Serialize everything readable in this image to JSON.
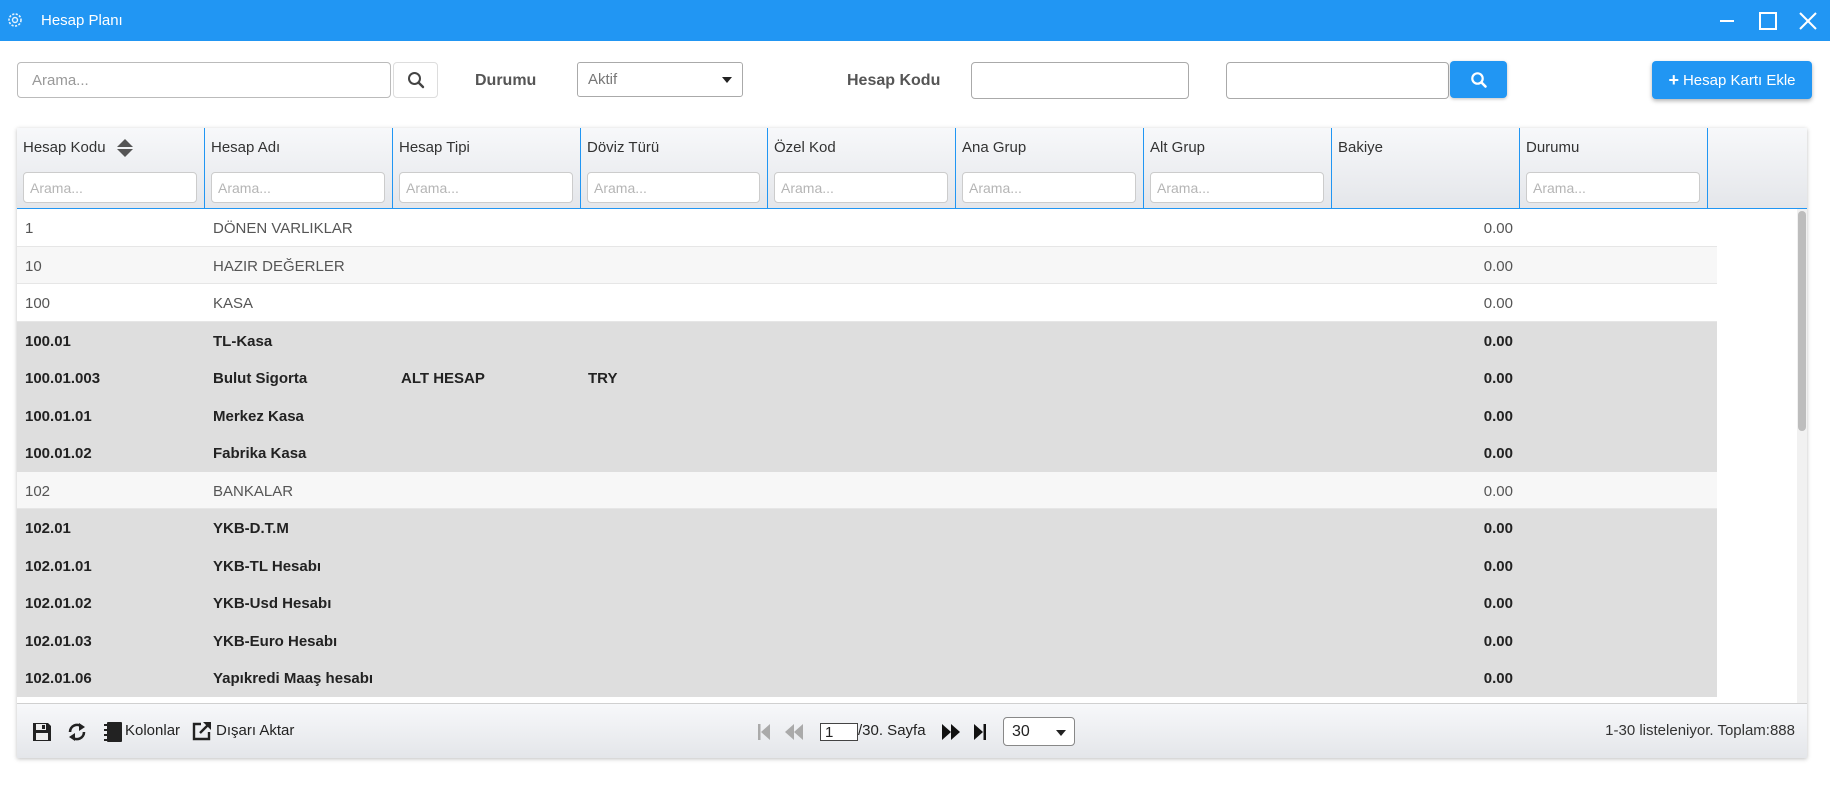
{
  "window": {
    "title": "Hesap Planı",
    "controls": [
      "minimize-icon",
      "maximize-icon",
      "close-icon"
    ]
  },
  "toolbar": {
    "search_placeholder": "Arama...",
    "status_label": "Durumu",
    "status_value": "Aktif",
    "account_code_label": "Hesap Kodu",
    "account_code_value": "",
    "secondary_value": "",
    "add_button_label": "Hesap Kartı Ekle"
  },
  "grid": {
    "columns": [
      {
        "label": "Hesap Kodu",
        "filter_placeholder": "Arama..."
      },
      {
        "label": "Hesap Adı",
        "filter_placeholder": "Arama..."
      },
      {
        "label": "Hesap Tipi",
        "filter_placeholder": "Arama..."
      },
      {
        "label": "Döviz Türü",
        "filter_placeholder": "Arama..."
      },
      {
        "label": "Özel Kod",
        "filter_placeholder": "Arama..."
      },
      {
        "label": "Ana Grup",
        "filter_placeholder": "Arama..."
      },
      {
        "label": "Alt Grup",
        "filter_placeholder": "Arama..."
      },
      {
        "label": "Bakiye",
        "filter_placeholder": ""
      },
      {
        "label": "Durumu",
        "filter_placeholder": "Arama..."
      }
    ],
    "rows": [
      {
        "code": "1",
        "name": "DÖNEN VARLIKLAR",
        "type": "",
        "currency": "",
        "balance": "0.00",
        "style": "white"
      },
      {
        "code": "10",
        "name": "HAZIR DEĞERLER",
        "type": "",
        "currency": "",
        "balance": "0.00",
        "style": "light"
      },
      {
        "code": "100",
        "name": "KASA",
        "type": "",
        "currency": "",
        "balance": "0.00",
        "style": "white"
      },
      {
        "code": "100.01",
        "name": "TL-Kasa",
        "type": "",
        "currency": "",
        "balance": "0.00",
        "style": "grey"
      },
      {
        "code": "100.01.003",
        "name": "Bulut Sigorta",
        "type": "ALT HESAP",
        "currency": "TRY",
        "balance": "0.00",
        "style": "grey"
      },
      {
        "code": "100.01.01",
        "name": "Merkez Kasa",
        "type": "",
        "currency": "",
        "balance": "0.00",
        "style": "grey"
      },
      {
        "code": "100.01.02",
        "name": "Fabrika Kasa",
        "type": "",
        "currency": "",
        "balance": "0.00",
        "style": "grey"
      },
      {
        "code": "102",
        "name": "BANKALAR",
        "type": "",
        "currency": "",
        "balance": "0.00",
        "style": "light"
      },
      {
        "code": "102.01",
        "name": "YKB-D.T.M",
        "type": "",
        "currency": "",
        "balance": "0.00",
        "style": "grey"
      },
      {
        "code": "102.01.01",
        "name": "YKB-TL Hesabı",
        "type": "",
        "currency": "",
        "balance": "0.00",
        "style": "grey"
      },
      {
        "code": "102.01.02",
        "name": "YKB-Usd Hesabı",
        "type": "",
        "currency": "",
        "balance": "0.00",
        "style": "grey"
      },
      {
        "code": "102.01.03",
        "name": "YKB-Euro Hesabı",
        "type": "",
        "currency": "",
        "balance": "0.00",
        "style": "grey"
      },
      {
        "code": "102.01.06",
        "name": "Yapıkredi Maaş hesabı",
        "type": "",
        "currency": "",
        "balance": "0.00",
        "style": "grey"
      }
    ]
  },
  "footer": {
    "columns_label": "Kolonlar",
    "export_label": "Dışarı Aktar",
    "current_page": "1",
    "page_suffix": "/30. Sayfa",
    "page_size": "30",
    "summary": "1-30 listeleniyor. Toplam:888"
  },
  "colors": {
    "accent": "#2196f3",
    "grey_row": "#dedede"
  }
}
